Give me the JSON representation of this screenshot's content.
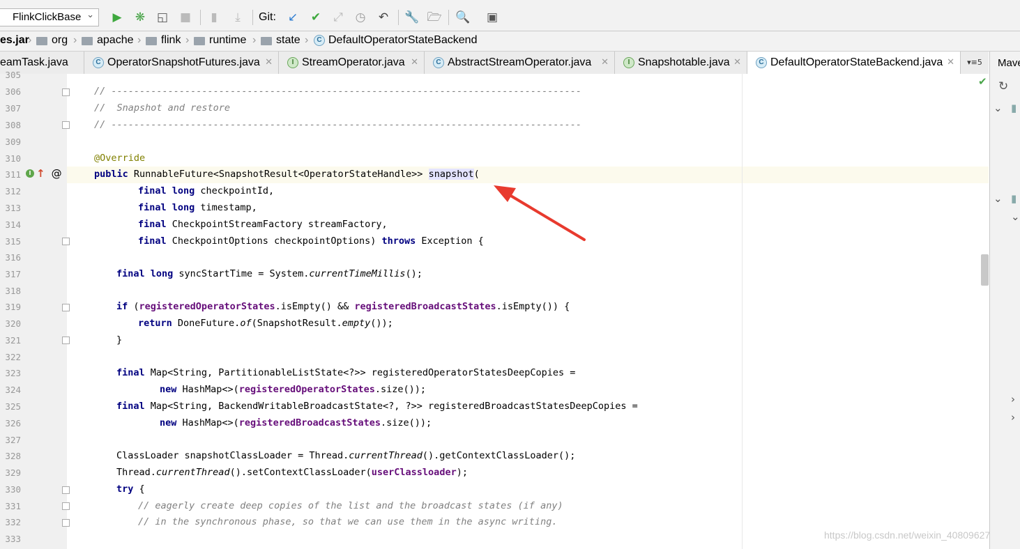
{
  "toolbar": {
    "run_config": "FlinkClickBase",
    "git_label": "Git:"
  },
  "breadcrumb": {
    "items": [
      "es.jar",
      "org",
      "apache",
      "flink",
      "runtime",
      "state",
      "DefaultOperatorStateBackend"
    ]
  },
  "tabs": [
    {
      "label": "eamTask.java",
      "badge": "C"
    },
    {
      "label": "OperatorSnapshotFutures.java",
      "badge": "C"
    },
    {
      "label": "StreamOperator.java",
      "badge": "I"
    },
    {
      "label": "AbstractStreamOperator.java",
      "badge": "C"
    },
    {
      "label": "Snapshotable.java",
      "badge": "I"
    },
    {
      "label": "DefaultOperatorStateBackend.java",
      "badge": "C"
    }
  ],
  "tab_overflow": "5",
  "right_panel": {
    "title": "Mave"
  },
  "line_numbers": [
    "305",
    "306",
    "307",
    "308",
    "309",
    "310",
    "311",
    "312",
    "313",
    "314",
    "315",
    "316",
    "317",
    "318",
    "319",
    "320",
    "321",
    "322",
    "323",
    "324",
    "325",
    "326",
    "327",
    "328",
    "329",
    "330",
    "331",
    "332",
    "333"
  ],
  "code": {
    "l306": "// -----------------------------------------------------------------------------------",
    "l307": "//  Snapshot and restore",
    "l308": "// -----------------------------------------------------------------------------------",
    "l310": "@Override",
    "l311_kw": "public",
    "l311_type": " RunnableFuture<SnapshotResult<OperatorStateHandle>> ",
    "l311_method": "snapshot",
    "l311_end": "(",
    "final": "final",
    "long": "long",
    "l312_rest": " checkpointId,",
    "l313_rest": " timestamp,",
    "l314_rest": " CheckpointStreamFactory streamFactory,",
    "l315_rest": " CheckpointOptions checkpointOptions) ",
    "throws": "throws",
    "l315_end": " Exception {",
    "l317_a": " syncStartTime = System.",
    "l317_b": "currentTimeMillis",
    "l317_c": "();",
    "if": "if",
    "l319_a": " (",
    "registeredOperatorStates": "registeredOperatorStates",
    "l319_b": ".isEmpty() && ",
    "registeredBroadcastStates": "registeredBroadcastStates",
    "l319_c": ".isEmpty()) {",
    "return": "return",
    "l320_a": " DoneFuture.",
    "of": "of",
    "l320_b": "(SnapshotResult.",
    "empty": "empty",
    "l320_c": "());",
    "l321": "}",
    "l323_rest": " Map<String, PartitionableListState<?>> registeredOperatorStatesDeepCopies =",
    "new": "new",
    "l324_a": " HashMap<>(",
    "l324_b": ".size());",
    "l325_rest": " Map<String, BackendWritableBroadcastState<?, ?>> registeredBroadcastStatesDeepCopies =",
    "l328_a": "ClassLoader snapshotClassLoader = Thread.",
    "currentThread": "currentThread",
    "l328_b": "().getContextClassLoader();",
    "l329_a": "Thread.",
    "l329_b": "().setContextClassLoader(",
    "userClassloader": "userClassloader",
    "l329_c": ");",
    "try": "try",
    "l330_rest": " {",
    "l331": "// eagerly create deep copies of the list and the broadcast states (if any)",
    "l332": "// in the synchronous phase, so that we can use them in the async writing."
  },
  "watermark": "https://blog.csdn.net/weixin_40809627",
  "colors": {
    "arrow": "#e83a2e",
    "keyword": "#000080",
    "field": "#660e7a",
    "comment": "#808080",
    "annotation": "#808000"
  }
}
